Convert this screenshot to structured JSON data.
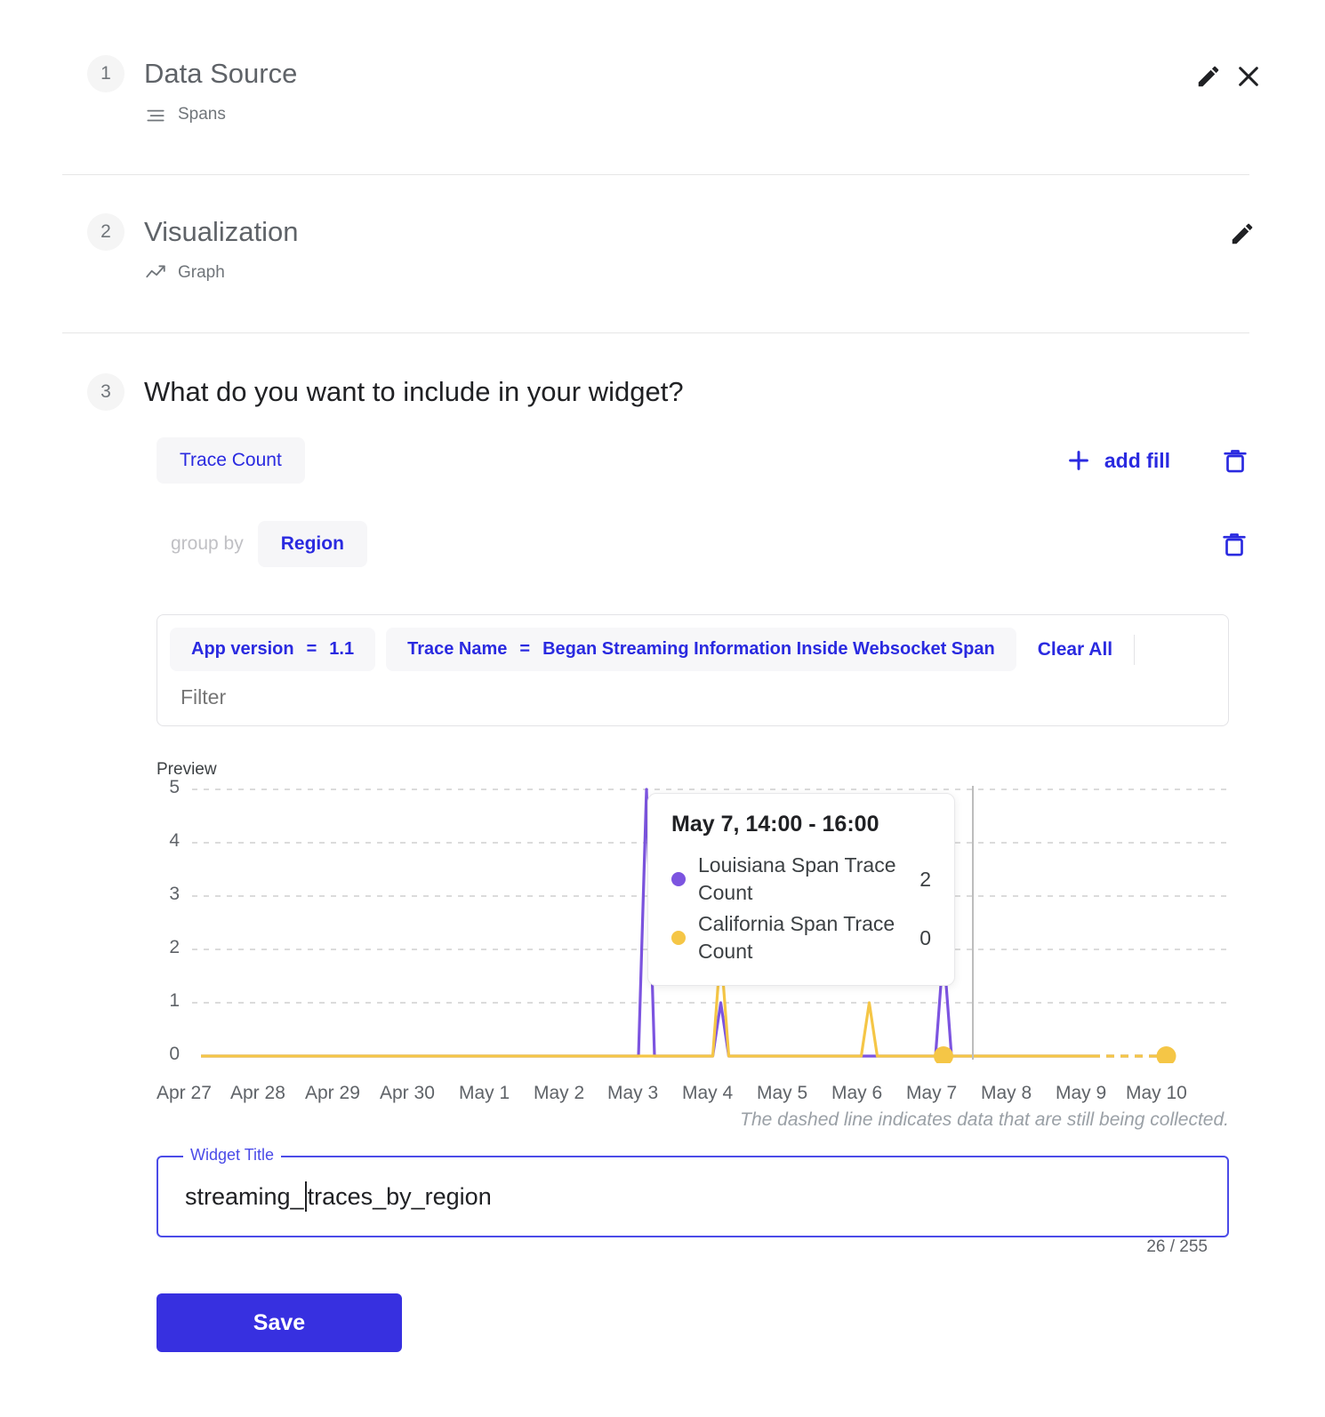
{
  "steps": [
    {
      "num": "1",
      "title": "Data Source",
      "sub_label": "Spans",
      "sub_icon": "data-source-icon"
    },
    {
      "num": "2",
      "title": "Visualization",
      "sub_label": "Graph",
      "sub_icon": "graph-icon"
    }
  ],
  "step3": {
    "num": "3",
    "title": "What do you want to include in your widget?",
    "metric_chip": "Trace Count",
    "add_fill_label": "add fill",
    "group_by_label": "group by",
    "group_by_chip": "Region",
    "filters": [
      {
        "key": "App version",
        "op": "=",
        "value": "1.1"
      },
      {
        "key": "Trace Name",
        "op": "=",
        "value": "Began Streaming Information Inside Websocket Span"
      }
    ],
    "clear_all_label": "Clear All",
    "filter_placeholder": "Filter",
    "preview_label": "Preview",
    "chart_note": "The dashed line indicates data that are still being collected.",
    "widget_title_legend": "Widget Title",
    "widget_title_value": "streaming_traces_by_region",
    "widget_title_caret_after": "streaming_",
    "widget_title_rest": "traces_by_region",
    "char_counter": "26 / 255",
    "save_label": "Save"
  },
  "tooltip": {
    "title": "May 7, 14:00 - 16:00",
    "rows": [
      {
        "label": "Louisiana Span Trace Count",
        "value": "2",
        "color": "#7c54e0"
      },
      {
        "label": "California Span Trace Count",
        "value": "0",
        "color": "#f5c646"
      }
    ]
  },
  "colors": {
    "accent": "#2a2ae0",
    "save": "#3730e0",
    "louisiana": "#7c54e0",
    "california": "#f5c646",
    "grid": "#cfcfcf"
  },
  "chart_data": {
    "type": "line",
    "title": "Preview",
    "xlabel": "",
    "ylabel": "",
    "ylim": [
      0,
      5
    ],
    "yticks": [
      "5",
      "4",
      "3",
      "2",
      "1",
      "0"
    ],
    "grid": true,
    "legend": "none",
    "categories": [
      "Apr 27",
      "Apr 28",
      "Apr 29",
      "Apr 30",
      "May 1",
      "May 2",
      "May 3",
      "May 4",
      "May 5",
      "May 6",
      "May 7",
      "May 8",
      "May 9",
      "May 10"
    ],
    "series": [
      {
        "name": "Louisiana Span Trace Count",
        "color": "#7c54e0",
        "points": [
          {
            "x": "Apr 27",
            "y": 0
          },
          {
            "x": "Apr 28",
            "y": 0
          },
          {
            "x": "Apr 29",
            "y": 0
          },
          {
            "x": "Apr 30",
            "y": 0
          },
          {
            "x": "May 1",
            "y": 0
          },
          {
            "x": "May 2",
            "y": 0
          },
          {
            "x": "May 3",
            "y": 5
          },
          {
            "x": "May 4",
            "y": 1
          },
          {
            "x": "May 5",
            "y": 0
          },
          {
            "x": "May 6",
            "y": 0
          },
          {
            "x": "May 7",
            "y": 2
          },
          {
            "x": "May 8",
            "y": 0
          },
          {
            "x": "May 9",
            "y": 0
          },
          {
            "x": "May 10",
            "y": 0
          }
        ]
      },
      {
        "name": "California Span Trace Count",
        "color": "#f5c646",
        "points": [
          {
            "x": "Apr 27",
            "y": 0
          },
          {
            "x": "Apr 28",
            "y": 0
          },
          {
            "x": "Apr 29",
            "y": 0
          },
          {
            "x": "Apr 30",
            "y": 0
          },
          {
            "x": "May 1",
            "y": 0
          },
          {
            "x": "May 2",
            "y": 0
          },
          {
            "x": "May 3",
            "y": 0
          },
          {
            "x": "May 4",
            "y": 2
          },
          {
            "x": "May 5",
            "y": 0
          },
          {
            "x": "May 6",
            "y": 1
          },
          {
            "x": "May 7",
            "y": 0
          },
          {
            "x": "May 8",
            "y": 0
          },
          {
            "x": "May 9",
            "y": 0
          },
          {
            "x": "May 10",
            "y": 0
          }
        ]
      }
    ],
    "hover": {
      "x": "May 7",
      "louisiana": 2,
      "california": 0
    },
    "note": "The dashed line indicates data that are still being collected."
  }
}
